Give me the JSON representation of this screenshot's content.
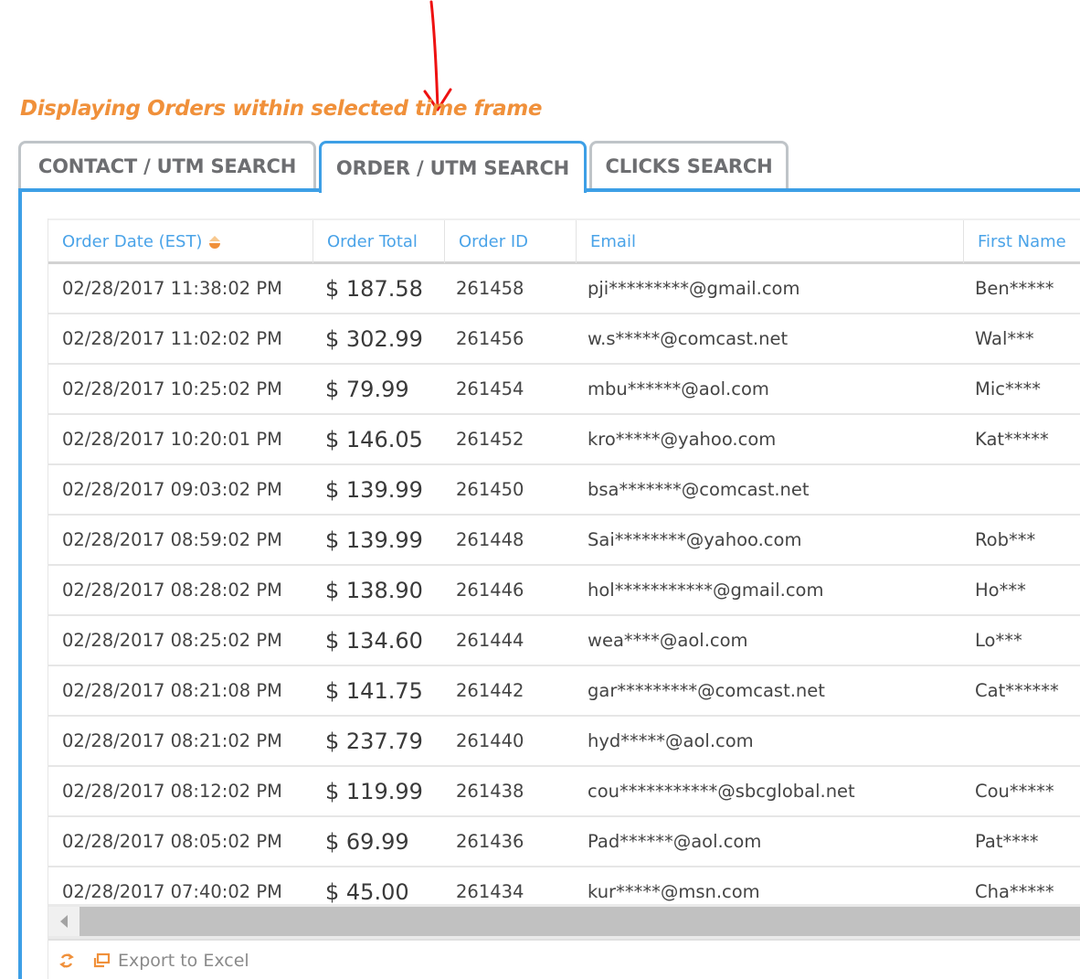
{
  "headline": "Displaying Orders within selected time frame",
  "annotation": {
    "icon": "red-arrow-down"
  },
  "tabs": [
    {
      "label": "CONTACT / UTM SEARCH",
      "active": false
    },
    {
      "label": "ORDER / UTM SEARCH",
      "active": true
    },
    {
      "label": "CLICKS SEARCH",
      "active": false
    }
  ],
  "colors": {
    "accent": "#3d9fe6",
    "headline": "#f0903a",
    "header_text": "#4aa3e8",
    "tab_inactive_border": "#bfc4c8"
  },
  "grid": {
    "columns": [
      {
        "label": "Order Date (EST)",
        "sort": "descending"
      },
      {
        "label": "Order Total"
      },
      {
        "label": "Order ID"
      },
      {
        "label": "Email"
      },
      {
        "label": "First Name"
      }
    ],
    "rows": [
      {
        "date": "02/28/2017 11:38:02 PM",
        "total": "$ 187.58",
        "id": "261458",
        "email": "pji*********@gmail.com",
        "first": "Ben*****"
      },
      {
        "date": "02/28/2017 11:02:02 PM",
        "total": "$ 302.99",
        "id": "261456",
        "email": "w.s*****@comcast.net",
        "first": "Wal***"
      },
      {
        "date": "02/28/2017 10:25:02 PM",
        "total": "$ 79.99",
        "id": "261454",
        "email": "mbu******@aol.com",
        "first": "Mic****"
      },
      {
        "date": "02/28/2017 10:20:01 PM",
        "total": "$ 146.05",
        "id": "261452",
        "email": "kro*****@yahoo.com",
        "first": "Kat*****"
      },
      {
        "date": "02/28/2017 09:03:02 PM",
        "total": "$ 139.99",
        "id": "261450",
        "email": "bsa*******@comcast.net",
        "first": ""
      },
      {
        "date": "02/28/2017 08:59:02 PM",
        "total": "$ 139.99",
        "id": "261448",
        "email": "Sai********@yahoo.com",
        "first": "Rob***"
      },
      {
        "date": "02/28/2017 08:28:02 PM",
        "total": "$ 138.90",
        "id": "261446",
        "email": "hol***********@gmail.com",
        "first": "Ho***"
      },
      {
        "date": "02/28/2017 08:25:02 PM",
        "total": "$ 134.60",
        "id": "261444",
        "email": "wea****@aol.com",
        "first": "Lo***"
      },
      {
        "date": "02/28/2017 08:21:08 PM",
        "total": "$ 141.75",
        "id": "261442",
        "email": "gar*********@comcast.net",
        "first": "Cat******"
      },
      {
        "date": "02/28/2017 08:21:02 PM",
        "total": "$ 237.79",
        "id": "261440",
        "email": "hyd*****@aol.com",
        "first": ""
      },
      {
        "date": "02/28/2017 08:12:02 PM",
        "total": "$ 119.99",
        "id": "261438",
        "email": "cou***********@sbcglobal.net",
        "first": "Cou*****"
      },
      {
        "date": "02/28/2017 08:05:02 PM",
        "total": "$ 69.99",
        "id": "261436",
        "email": "Pad******@aol.com",
        "first": "Pat****"
      },
      {
        "date": "02/28/2017 07:40:02 PM",
        "total": "$ 45.00",
        "id": "261434",
        "email": "kur*****@msn.com",
        "first": "Cha*****"
      }
    ]
  },
  "footer": {
    "refresh_icon": "refresh-icon",
    "export_icon": "export-icon",
    "export_label": "Export to Excel"
  }
}
